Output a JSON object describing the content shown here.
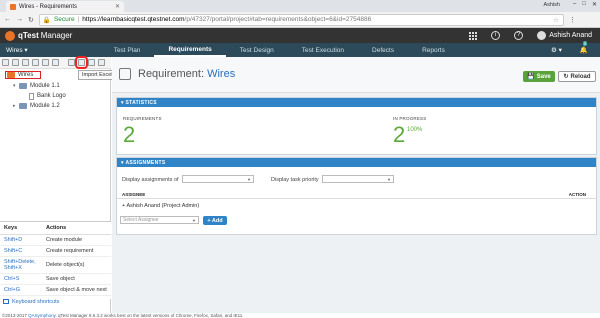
{
  "browser": {
    "tab_title": "Wires - Requirements",
    "user": "Ashish",
    "secure_label": "Secure",
    "url_host": "https://learnbasicqtest.qtestnet.com",
    "url_path": "/p/47327/portal/project#tab=requirements&object=6&id=2754886"
  },
  "app": {
    "logo_brand": "qTest",
    "logo_product": "Manager",
    "user_name": "Ashish Anand",
    "notification_count": "0"
  },
  "nav": {
    "project": "Wires ▾",
    "tabs": [
      "Test Plan",
      "Requirements",
      "Test Design",
      "Test Execution",
      "Defects",
      "Reports"
    ],
    "active_tab": "Requirements"
  },
  "tree": {
    "tooltip": "Import Excel",
    "root": "Wires",
    "items": [
      {
        "label": "Module 1.1"
      },
      {
        "label": "Bank Logo"
      },
      {
        "label": "Module 1.2"
      }
    ]
  },
  "keys": {
    "col_keys": "Keys",
    "col_actions": "Actions",
    "rows": [
      {
        "key": "Shift+D",
        "action": "Create module"
      },
      {
        "key": "Shift+C",
        "action": "Create requirement"
      },
      {
        "key": "Shift+Delete, Shift+X",
        "action": "Delete object(s)"
      },
      {
        "key": "Ctrl+S",
        "action": "Save object"
      },
      {
        "key": "Ctrl+G",
        "action": "Save object & move next"
      }
    ],
    "shortcuts_link": "Keyboard shortcuts"
  },
  "requirement": {
    "label": "Requirement: ",
    "name": "Wires",
    "save": "Save",
    "reload": "Reload"
  },
  "statistics": {
    "title": "STATISTICS",
    "requirements_label": "REQUIREMENTS",
    "requirements_value": "2",
    "in_progress_label": "IN PROGRESS",
    "in_progress_value": "2",
    "in_progress_pct": "100%"
  },
  "assignments": {
    "title": "ASSIGNMENTS",
    "display_of_label": "Display assignments of",
    "task_priority_label": "Display task priority",
    "col_assignee": "ASSIGNEE",
    "col_action": "ACTION",
    "assignee": "Ashish Anand (Project Admin)",
    "select_placeholder": "Select Assignee",
    "add_button": "+ Add"
  },
  "footer": {
    "copyright": "©2013-2017 ",
    "company": "QASymphony",
    "note": ". qTest Manager 8.6.3.2 works best on the latest versions of Chrome, Firefox, Safari, and IE11."
  },
  "colors": {
    "header": "#333333",
    "nav": "#2c4a5a",
    "panel_head": "#2e84c6",
    "save": "#5aa23b",
    "stat_value": "#5aaa3a"
  }
}
